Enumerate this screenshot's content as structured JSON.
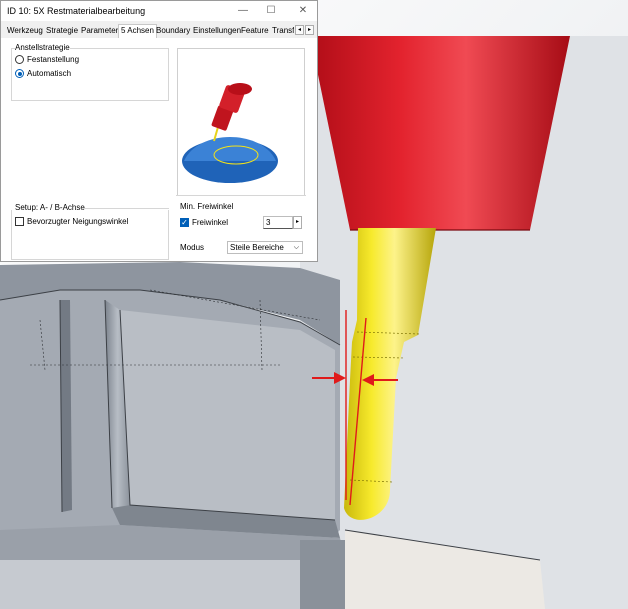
{
  "window": {
    "title": "ID 10: 5X Restmaterialbearbeitung",
    "minimize": "—",
    "maximize": "☐",
    "close": "✕"
  },
  "tabs": [
    {
      "label": "Werkzeug"
    },
    {
      "label": "Strategie"
    },
    {
      "label": "Parameter"
    },
    {
      "label": "5 Achsen"
    },
    {
      "label": "Boundary"
    },
    {
      "label": "Einstellungen"
    },
    {
      "label": "Feature"
    },
    {
      "label": "Transfo"
    }
  ],
  "tab_nav": {
    "prev": "◂",
    "next": "▸"
  },
  "anstellstrategie": {
    "title": "Anstellstrategie",
    "options": [
      {
        "label": "Festanstellung",
        "selected": false
      },
      {
        "label": "Automatisch",
        "selected": true
      }
    ]
  },
  "setup": {
    "title": "Setup: A- / B-Achse",
    "checkbox_label": "Bevorzugter Neigungswinkel",
    "checked": false
  },
  "min_freiwinkel": {
    "title": "Min. Freiwinkel",
    "checkbox_label": "Freiwinkel",
    "checked": true,
    "check_glyph": "✓",
    "value": "3",
    "spin_glyph": "▸",
    "modus_label": "Modus",
    "modus_value": "Steile Bereiche",
    "dropdown_glyph": "⌵"
  },
  "colors": {
    "holder_red": "#d0121e",
    "tool_yellow": "#f2e21a",
    "part_gray": "#9aa1ab",
    "arrow_red": "#e01a1a",
    "accent_blue": "#005fb8"
  },
  "icons": {
    "tool-preview": "5-axis tool illustration",
    "clearance-arrows": "red arrows marking clearance angle"
  }
}
